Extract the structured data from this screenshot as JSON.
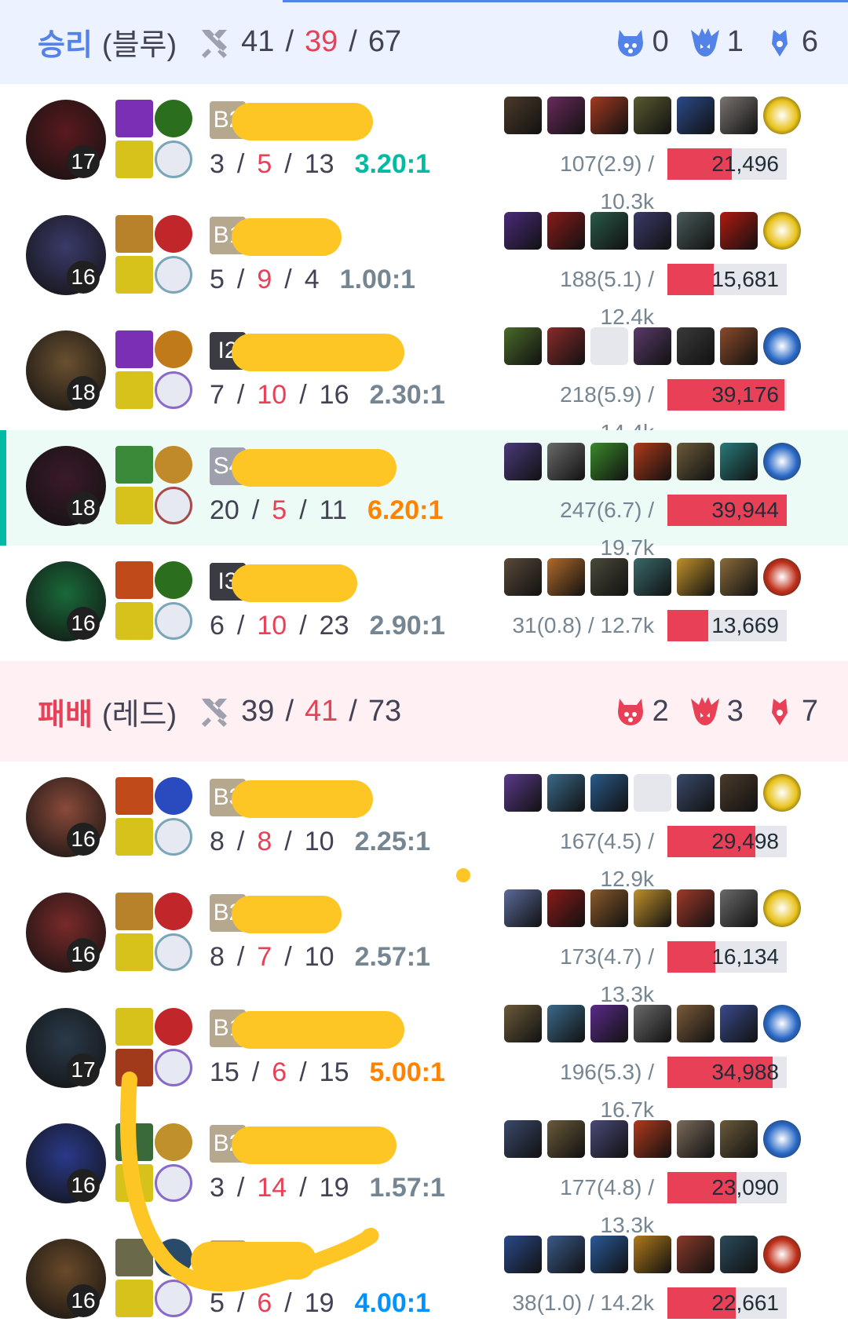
{
  "blue": {
    "result": "승리",
    "team": "(블루)",
    "kills": "41",
    "deaths": "39",
    "assists": "67",
    "baron": "0",
    "dragon": "1",
    "herald": "6",
    "players": [
      {
        "level": "17",
        "tier": "B2",
        "k": "3",
        "d": "5",
        "a": "13",
        "ratio": "3.20:1",
        "ratio_class": "great",
        "cs": "107(2.9) / 10.3k",
        "damage": "21,496",
        "damage_pct": 0.54,
        "champ_color": "#5a1a1f",
        "spells": [
          "#7a2fb5",
          "#2b6e1e",
          "#d6c21a",
          "#7aa6b8"
        ],
        "items": [
          "#4b3a2a",
          "#6a2a5c",
          "#a33a20",
          "#5a5a30",
          "#2a4a8a",
          "#7a7470",
          "ward-yellow"
        ]
      },
      {
        "level": "16",
        "tier": "B1",
        "k": "5",
        "d": "9",
        "a": "4",
        "ratio": "1.00:1",
        "ratio_class": "normal",
        "cs": "188(5.1) / 12.4k",
        "damage": "15,681",
        "damage_pct": 0.39,
        "champ_color": "#3a3b6a",
        "spells": [
          "#b8822a",
          "#c0262a",
          "#d6c21a",
          "#7aa6b8"
        ],
        "items": [
          "#4a2a7a",
          "#8a1a1a",
          "#2a5a4a",
          "#3a3a6a",
          "#4a5a5a",
          "#b01a10",
          "ward-yellow"
        ]
      },
      {
        "level": "18",
        "tier": "I2",
        "k": "7",
        "d": "10",
        "a": "16",
        "ratio": "2.30:1",
        "ratio_class": "normal",
        "cs": "218(5.9) / 14.4k",
        "damage": "39,176",
        "damage_pct": 0.98,
        "champ_color": "#6a5030",
        "spells": [
          "#7a2fb5",
          "#c07a1a",
          "#d6c21a",
          "#8a6ac8"
        ],
        "items": [
          "#4a6a2a",
          "#8a2a2a",
          "empty",
          "#5a3a6a",
          "#3a3a3a",
          "#8a4a2a",
          "ward-blue"
        ]
      },
      {
        "level": "18",
        "tier": "S4",
        "k": "20",
        "d": "5",
        "a": "11",
        "ratio": "6.20:1",
        "ratio_class": "excellent",
        "cs": "247(6.7) / 19.7k",
        "damage": "39,944",
        "damage_pct": 1.0,
        "champ_color": "#3a1a2a",
        "spells": [
          "#3a8a3a",
          "#c08a2a",
          "#d6c21a",
          "#a84a4a"
        ],
        "items": [
          "#4a3a7a",
          "#6a6a6a",
          "#3a8a2a",
          "#b03a1a",
          "#6a5a3a",
          "#2a7a7a",
          "ward-blue"
        ]
      },
      {
        "level": "16",
        "tier": "I3",
        "k": "6",
        "d": "10",
        "a": "23",
        "ratio": "2.90:1",
        "ratio_class": "normal",
        "cs": "31(0.8) / 12.7k",
        "damage": "13,669",
        "damage_pct": 0.34,
        "champ_color": "#1a6a3a",
        "spells": [
          "#c04a1a",
          "#2b6e1e",
          "#d6c21a",
          "#7aa6b8"
        ],
        "items": [
          "#5a4a3a",
          "#b06a2a",
          "#4a4a3a",
          "#3a6a6a",
          "#c0902a",
          "#8a6a3a",
          "ward-red"
        ]
      }
    ]
  },
  "red": {
    "result": "패배",
    "team": "(레드)",
    "kills": "39",
    "deaths": "41",
    "assists": "73",
    "baron": "2",
    "dragon": "3",
    "herald": "7",
    "players": [
      {
        "level": "16",
        "tier": "B3",
        "k": "8",
        "d": "8",
        "a": "10",
        "ratio": "2.25:1",
        "ratio_class": "normal",
        "cs": "167(4.5) / 12.9k",
        "damage": "29,498",
        "damage_pct": 0.74,
        "champ_color": "#8a4a3a",
        "spells": [
          "#c04a1a",
          "#2a4ac0",
          "#d6c21a",
          "#7aa6b8"
        ],
        "items": [
          "#5a3a8a",
          "#3a6a8a",
          "#2a5a8a",
          "empty",
          "#3a4a6a",
          "#4a3a2a",
          "ward-yellow"
        ]
      },
      {
        "level": "16",
        "tier": "B2",
        "k": "8",
        "d": "7",
        "a": "10",
        "ratio": "2.57:1",
        "ratio_class": "normal",
        "cs": "173(4.7) / 13.3k",
        "damage": "16,134",
        "damage_pct": 0.4,
        "champ_color": "#7a2a2a",
        "spells": [
          "#b8822a",
          "#c0262a",
          "#d6c21a",
          "#7aa6b8"
        ],
        "items": [
          "#5a6a9a",
          "#8a1a1a",
          "#8a5a2a",
          "#c0902a",
          "#a03a2a",
          "#6a6a6a",
          "ward-yellow"
        ]
      },
      {
        "level": "17",
        "tier": "B1",
        "k": "15",
        "d": "6",
        "a": "15",
        "ratio": "5.00:1",
        "ratio_class": "excellent",
        "cs": "196(5.3) / 16.7k",
        "damage": "34,988",
        "damage_pct": 0.88,
        "champ_color": "#2a3a4a",
        "spells": [
          "#d6c21a",
          "#c0262a",
          "#a03a1a",
          "#8a6ac8"
        ],
        "items": [
          "#6a5a3a",
          "#3a6a8a",
          "#5a2a8a",
          "#6a6a6a",
          "#7a5a3a",
          "#3a4a8a",
          "ward-blue"
        ]
      },
      {
        "level": "16",
        "tier": "B2",
        "k": "3",
        "d": "14",
        "a": "19",
        "ratio": "1.57:1",
        "ratio_class": "normal",
        "cs": "177(4.8) / 13.3k",
        "damage": "23,090",
        "damage_pct": 0.58,
        "champ_color": "#2a3a8a",
        "spells": [
          "#3a6a3a",
          "#c0902a",
          "#d6c21a",
          "#8a6ac8"
        ],
        "items": [
          "#3a4a6a",
          "#6a5a3a",
          "#4a4a7a",
          "#b03a1a",
          "#7a6a5a",
          "#6a5a3a",
          "ward-blue"
        ]
      },
      {
        "level": "16",
        "tier": "B4",
        "k": "5",
        "d": "6",
        "a": "19",
        "ratio": "4.00:1",
        "ratio_class": "good",
        "cs": "38(1.0) / 14.2k",
        "damage": "22,661",
        "damage_pct": 0.57,
        "champ_color": "#6a4a2a",
        "spells": [
          "#6a6a4a",
          "#2a4a6a",
          "#d6c21a",
          "#8a6ac8"
        ],
        "items": [
          "#2a4a8a",
          "#3a5a8a",
          "#2a5a9a",
          "#b07a1a",
          "#8a3a2a",
          "#2a4a5a",
          "ward-red"
        ]
      }
    ]
  }
}
